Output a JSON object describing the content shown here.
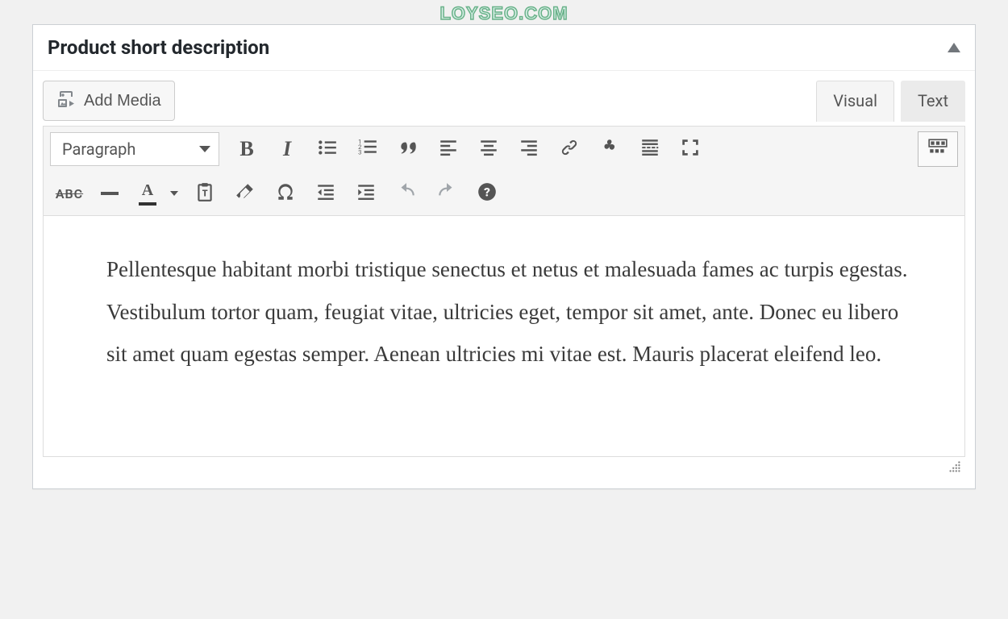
{
  "watermark": "LOYSEO.COM",
  "panel": {
    "title": "Product short description"
  },
  "media": {
    "add_media_label": "Add Media"
  },
  "tabs": {
    "visual": "Visual",
    "text": "Text"
  },
  "format_select": {
    "value": "Paragraph"
  },
  "toolbar_row1": {
    "bold": "B",
    "italic": "I"
  },
  "toolbar_row2": {
    "strike": "ABC",
    "textcolor_char": "A"
  },
  "editor": {
    "content": "Pellentesque habitant morbi tristique senectus et netus et malesuada fames ac turpis egestas. Vestibulum tortor quam, feugiat vitae, ultricies eget, tempor sit amet, ante. Donec eu libero sit amet quam egestas semper. Aenean ultricies mi vitae est. Mauris placerat eleifend leo."
  }
}
